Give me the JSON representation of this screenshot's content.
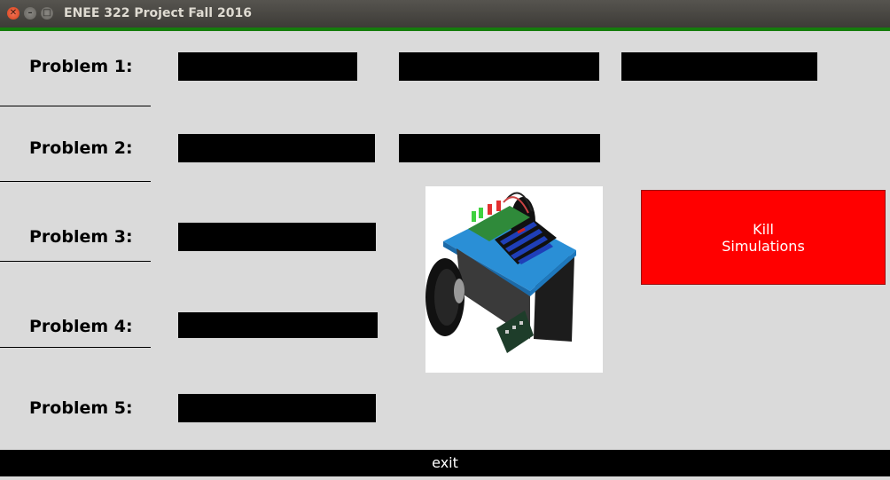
{
  "window": {
    "title": "ENEE 322 Project Fall 2016",
    "controls": [
      "close-icon",
      "minimize-icon",
      "maximize-icon"
    ]
  },
  "problems": [
    {
      "label": "Problem 1:"
    },
    {
      "label": "Problem 2:"
    },
    {
      "label": "Problem 3:"
    },
    {
      "label": "Problem 4:"
    },
    {
      "label": "Problem 5:"
    }
  ],
  "kill_button": {
    "line1": "Kill",
    "line2": "Simulations"
  },
  "exit_button": {
    "label": "exit"
  },
  "colors": {
    "titlebar": "#3d3b37",
    "accent_bar": "#157c0c",
    "kill": "#ff0000",
    "field": "#000000",
    "background": "#dadada"
  }
}
